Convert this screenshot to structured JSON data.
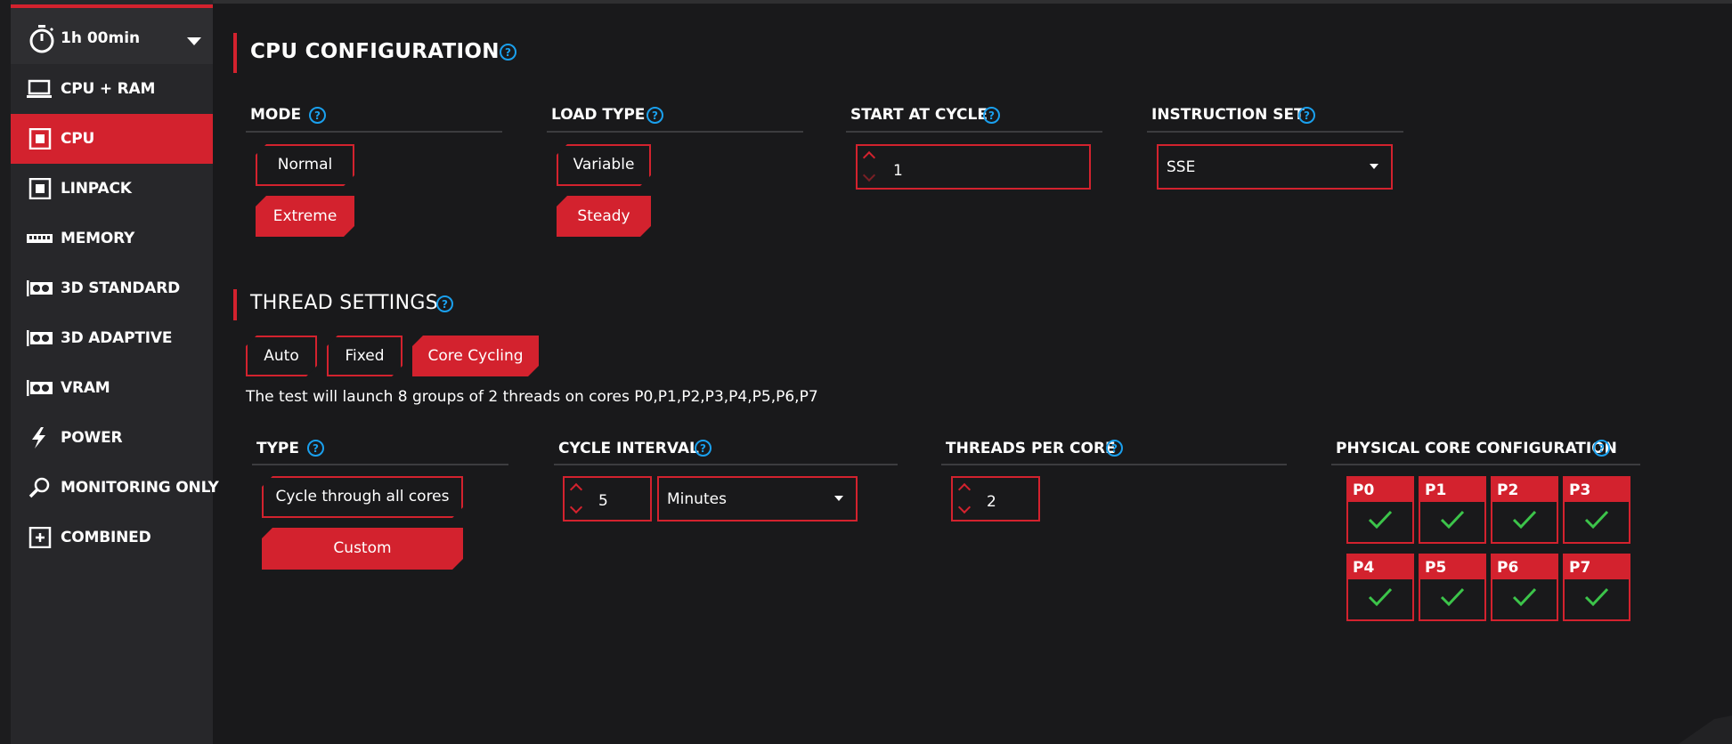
{
  "sidebar": {
    "timer": "1h 00min",
    "items": [
      {
        "label": "CPU + RAM",
        "icon": "laptop-icon"
      },
      {
        "label": "CPU",
        "icon": "cpu-icon",
        "active": true
      },
      {
        "label": "LINPACK",
        "icon": "linpack-icon"
      },
      {
        "label": "MEMORY",
        "icon": "memory-icon"
      },
      {
        "label": "3D STANDARD",
        "icon": "gpu-icon"
      },
      {
        "label": "3D ADAPTIVE",
        "icon": "gpu-icon"
      },
      {
        "label": "VRAM",
        "icon": "gpu-icon"
      },
      {
        "label": "POWER",
        "icon": "lightning-icon"
      },
      {
        "label": "MONITORING ONLY",
        "icon": "magnifier-icon"
      },
      {
        "label": "COMBINED",
        "icon": "plus-box-icon"
      }
    ]
  },
  "cpu_config": {
    "title": "CPU CONFIGURATION",
    "mode": {
      "title": "MODE",
      "options": [
        "Normal",
        "Extreme"
      ],
      "selected": "Extreme"
    },
    "load_type": {
      "title": "LOAD TYPE",
      "options": [
        "Variable",
        "Steady"
      ],
      "selected": "Steady"
    },
    "start_at_cycle": {
      "title": "START AT CYCLE",
      "value": "1"
    },
    "instruction_set": {
      "title": "INSTRUCTION SET",
      "value": "SSE"
    }
  },
  "thread_settings": {
    "title": "THREAD SETTINGS",
    "options": [
      "Auto",
      "Fixed",
      "Core Cycling"
    ],
    "selected": "Core Cycling",
    "info": "The test will launch 8 groups of 2 threads on cores P0,P1,P2,P3,P4,P5,P6,P7",
    "type": {
      "title": "TYPE",
      "options": [
        "Cycle through all cores",
        "Custom"
      ],
      "selected": "Custom"
    },
    "cycle_interval": {
      "title": "CYCLE INTERVAL",
      "value": "5",
      "unit": "Minutes"
    },
    "threads_per_core": {
      "title": "THREADS PER CORE",
      "value": "2"
    },
    "physical_cores": {
      "title": "PHYSICAL CORE CONFIGURATION",
      "cores": [
        {
          "label": "P0",
          "checked": true
        },
        {
          "label": "P1",
          "checked": true
        },
        {
          "label": "P2",
          "checked": true
        },
        {
          "label": "P3",
          "checked": true
        },
        {
          "label": "P4",
          "checked": true
        },
        {
          "label": "P5",
          "checked": true
        },
        {
          "label": "P6",
          "checked": true
        },
        {
          "label": "P7",
          "checked": true
        }
      ]
    }
  },
  "colors": {
    "accent": "#d3222e",
    "help": "#1aa0ee",
    "check": "#3cc44a",
    "background": "#19191b",
    "sidebar": "#27272a"
  }
}
